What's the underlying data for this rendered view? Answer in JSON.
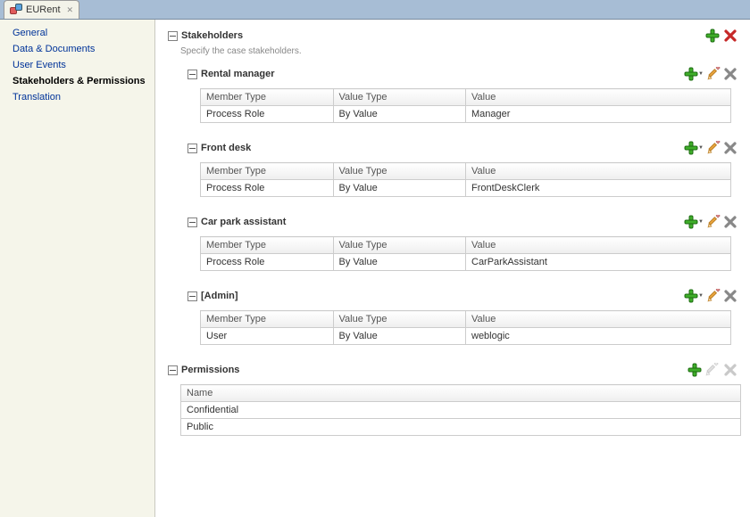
{
  "tab": {
    "title": "EURent"
  },
  "sidebar": {
    "items": [
      {
        "label": "General"
      },
      {
        "label": "Data & Documents"
      },
      {
        "label": "User Events"
      },
      {
        "label": "Stakeholders & Permissions",
        "selected": true
      },
      {
        "label": "Translation"
      }
    ]
  },
  "stakeholders_section": {
    "title": "Stakeholders",
    "description": "Specify the case stakeholders."
  },
  "table_headers": {
    "member_type": "Member Type",
    "value_type": "Value Type",
    "value": "Value"
  },
  "stakeholders": [
    {
      "name": "Rental manager",
      "member_type": "Process Role",
      "value_type": "By Value",
      "value": "Manager"
    },
    {
      "name": "Front desk",
      "member_type": "Process Role",
      "value_type": "By Value",
      "value": "FrontDeskClerk"
    },
    {
      "name": "Car park assistant",
      "member_type": "Process Role",
      "value_type": "By Value",
      "value": "CarParkAssistant"
    },
    {
      "name": "[Admin]",
      "member_type": "User",
      "value_type": "By Value",
      "value": "weblogic"
    }
  ],
  "permissions_section": {
    "title": "Permissions",
    "name_header": "Name",
    "rows": [
      "Confidential",
      "Public"
    ]
  }
}
